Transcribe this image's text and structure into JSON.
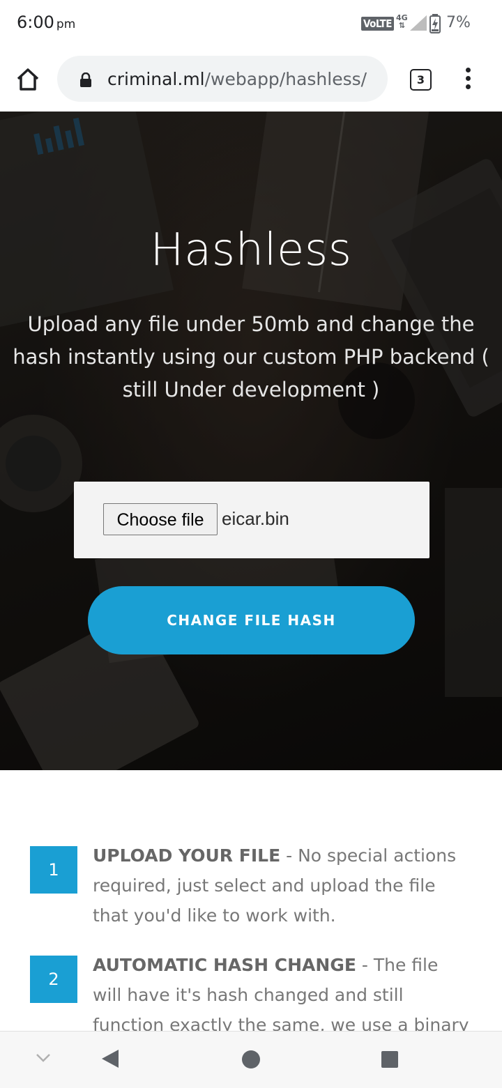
{
  "status_bar": {
    "time": "6:00",
    "ampm": "pm",
    "volte": "VoLTE",
    "network": "4G",
    "battery": "7%"
  },
  "browser": {
    "url_host": "criminal.ml",
    "url_path": "/webapp/hashless/",
    "tab_count": "3"
  },
  "hero": {
    "title": "Hashless",
    "subtitle": "Upload any file under 50mb and change the hash instantly using our custom PHP backend ( still Under development )",
    "choose_file_label": "Choose file",
    "file_name": "eicar.bin",
    "submit_label": "CHANGE FILE HASH"
  },
  "steps": [
    {
      "number": "1",
      "title": "UPLOAD YOUR FILE",
      "text": " - No special actions required,  just select and upload the file that you'd like to work with."
    },
    {
      "number": "2",
      "title": "AUTOMATIC HASH CHANGE",
      "text": " - The file will have it's hash changed and still function exactly the same, we use a binary Merge"
    }
  ],
  "colors": {
    "accent": "#1a9fd3",
    "hero_dark": "#1b1815"
  }
}
